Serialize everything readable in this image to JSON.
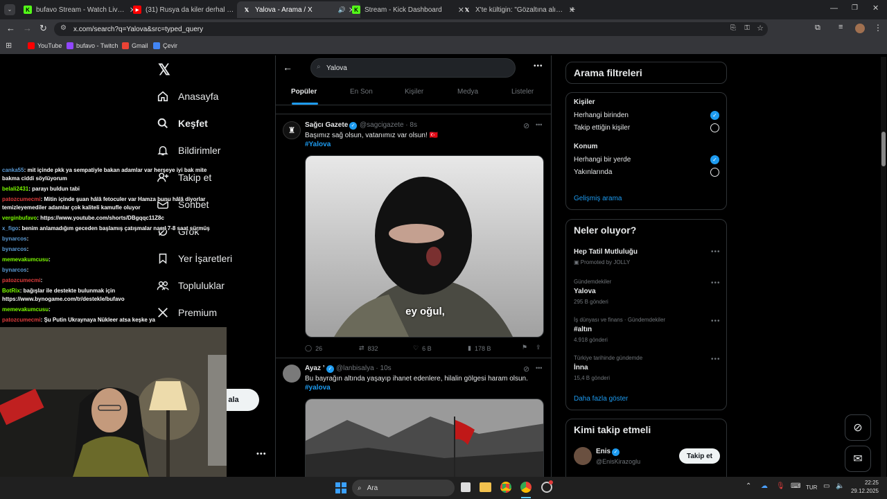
{
  "browser": {
    "tabs": [
      {
        "title": "bufavo Stream - Watch Live on",
        "fav_color": "#53fc18",
        "fav": "K"
      },
      {
        "title": "(31) Rusya da kiler derhal çıkın",
        "fav_color": "#ff0000",
        "fav": "▶"
      },
      {
        "title": "Yalova - Arama / X",
        "fav_color": "#000000",
        "fav": "X"
      },
      {
        "title": "Stream - Kick Dashboard",
        "fav_color": "#53fc18",
        "fav": "K"
      },
      {
        "title": "X'te kültigin: \"Gözaltına alınan i",
        "fav_color": "#000000",
        "fav": "X"
      }
    ],
    "url": "x.com/search?q=Yalova&src=typed_query",
    "bookmarks": [
      {
        "label": "YouTube",
        "color": "#ff0000"
      },
      {
        "label": "bufavo - Twitch",
        "color": "#9146ff"
      },
      {
        "label": "Gmail",
        "color": "#ea4335"
      },
      {
        "label": "Çevir",
        "color": "#4285f4"
      }
    ]
  },
  "nav": {
    "items": [
      "Anasayfa",
      "Keşfet",
      "Bildirimler",
      "Takip et",
      "Sohbet",
      "Grok",
      "Yer İşaretleri",
      "Topluluklar",
      "Premium"
    ],
    "post_button": "ala"
  },
  "search": {
    "query": "Yalova",
    "tabs": [
      "Popüler",
      "En Son",
      "Kişiler",
      "Medya",
      "Listeler"
    ]
  },
  "tweets": [
    {
      "name": "Sağcı Gazete",
      "handle": "@sagcigazete · 8s",
      "text": "Başımız sağ olsun, vatanımız var olsun! 🇹🇷",
      "hashtag": "#Yalova",
      "subtitle": "ey oğul,",
      "replies": "26",
      "reposts": "832",
      "likes": "6 B",
      "views": "178 B"
    },
    {
      "name": "Ayaz ’",
      "handle": "@lanbisalya · 10s",
      "text": "Bu bayrağın altında yaşayıp ihanet edenlere, hilalin gölgesi haram olsun.",
      "hashtag": "#yalova"
    }
  ],
  "filters": {
    "title": "Arama filtreleri",
    "people_label": "Kişiler",
    "people": [
      "Herhangi birinden",
      "Takip ettiğin kişiler"
    ],
    "location_label": "Konum",
    "location": [
      "Herhangi bir yerde",
      "Yakınlarında"
    ],
    "advanced": "Gelişmiş arama"
  },
  "trends": {
    "title": "Neler oluyor?",
    "items": [
      {
        "name": "Hep Tatil Mutluluğu",
        "meta": "Promoted by JOLLY",
        "sub": ""
      },
      {
        "meta": "Gündemdekiler",
        "name": "Yalova",
        "sub": "295 B gönderi"
      },
      {
        "meta": "İş dünyası ve finans · Gündemdekiler",
        "name": "#altın",
        "sub": "4.918 gönderi"
      },
      {
        "meta": "Türkiye tarihinde gündemde",
        "name": "İnna",
        "sub": "15,4 B gönderi"
      }
    ],
    "more": "Daha fazla göster"
  },
  "who_to_follow": {
    "title": "Kimi takip etmeli",
    "name": "Enis",
    "handle": "@EnisKirazoglu",
    "button": "Takip et"
  },
  "chat": [
    {
      "user": "canka55",
      "color": "#5b9bd5",
      "msg": ": mit içinde pkk ya sempatiyle bakan adamlar var herşeye iyi bak mite"
    },
    {
      "user": "",
      "color": "#ffffff",
      "msg": "bakma ciddi söylüyorum"
    },
    {
      "user": "belali2431",
      "color": "#7cfc00",
      "msg": ": parayı buldun tabi"
    },
    {
      "user": "patozcumecmi",
      "color": "#e03c3c",
      "msg": ": Mitin içinde şuan hâlâ fetoculer var Hamza bunu hâlâ diyorlar"
    },
    {
      "user": "",
      "color": "#ffffff",
      "msg": "temizleyemediler adamlar çok kaliteli kamufle oluyor"
    },
    {
      "user": "verginbufavo",
      "color": "#7cfc00",
      "msg": ": https://www.youtube.com/shorts/DBgqqc11Z8c"
    },
    {
      "user": "x_figo",
      "color": "#5b9bd5",
      "msg": ": benim anlamadığım geceden başlamış çatışmalar nasıl 7-8 saat sürmüş"
    },
    {
      "user": "bynarcos",
      "color": "#5b9bd5",
      "msg": ":"
    },
    {
      "user": "bynarcos",
      "color": "#5b9bd5",
      "msg": ":"
    },
    {
      "user": "memevakumcusu",
      "color": "#7cfc00",
      "msg": ":"
    },
    {
      "user": "bynarcos",
      "color": "#5b9bd5",
      "msg": ":"
    },
    {
      "user": "patozcumecmi",
      "color": "#e03c3c",
      "msg": ":"
    },
    {
      "user": "BotRix",
      "color": "#7cfc00",
      "msg": ": bağışlar ile destekte bulunmak için"
    },
    {
      "user": "",
      "color": "#ffffff",
      "msg": "https://www.bynogame.com/tr/destekle/bufavo"
    },
    {
      "user": "memevakumcusu",
      "color": "#7cfc00",
      "msg": ":"
    },
    {
      "user": "patozcumecmi",
      "color": "#e03c3c",
      "msg": ": Şu Putin Ukraynaya Nükleer atsa keşke ya"
    }
  ],
  "taskbar": {
    "search": "Ara",
    "lang": "TUR",
    "time": "22:25",
    "date": "29.12.2025"
  }
}
